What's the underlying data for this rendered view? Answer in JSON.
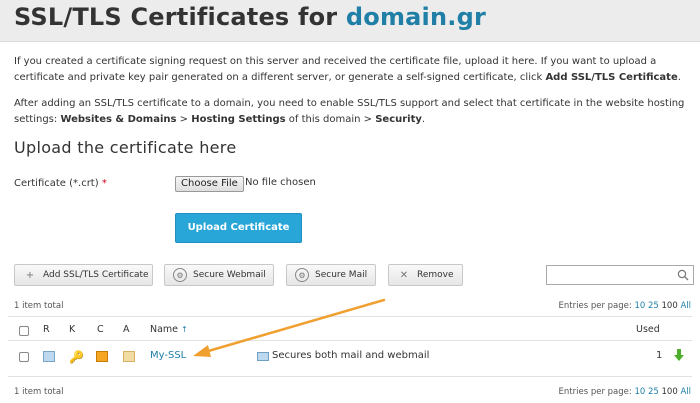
{
  "header": {
    "title_prefix": "SSL/TLS Certificates for ",
    "domain": "domain.gr"
  },
  "intro": {
    "p1_a": "If you created a certificate signing request on this server and received the certificate file, upload it here. If you want to upload a certificate and private key pair generated on a different server, or generate a self-signed certificate, click ",
    "p1_b": "Add SSL/TLS Certificate",
    "p1_c": ".",
    "p2_a": "After adding an SSL/TLS certificate to a domain, you need to enable SSL/TLS support and select that certificate in the website hosting settings: ",
    "p2_b": "Websites & Domains",
    "p2_c": " > ",
    "p2_d": "Hosting Settings",
    "p2_e": " of this domain > ",
    "p2_f": "Security",
    "p2_g": "."
  },
  "upload": {
    "section_title": "Upload the certificate here",
    "field_label": "Certificate (*.crt)",
    "required_mark": "*",
    "choose_file": "Choose File",
    "file_status": "No file chosen",
    "upload_button": "Upload Certificate"
  },
  "toolbar": {
    "add": "Add SSL/TLS Certificate",
    "webmail": "Secure Webmail",
    "mail": "Secure Mail",
    "remove": "Remove"
  },
  "list": {
    "total": "1 item total",
    "entries_label": "Entries per page: ",
    "entries_options": [
      "10",
      "25",
      "100",
      "All"
    ],
    "columns": {
      "r": "R",
      "k": "K",
      "c": "C",
      "a": "A",
      "name": "Name",
      "sort_icon": "↑",
      "used": "Used"
    },
    "rows": [
      {
        "name": "My-SSL",
        "description": "Secures both mail and webmail",
        "used": "1"
      }
    ]
  },
  "colors": {
    "accent": "#1f7fa6",
    "upload_button": "#28a6d8",
    "arrow": "#f0a030",
    "header_bg": "#ececec"
  }
}
